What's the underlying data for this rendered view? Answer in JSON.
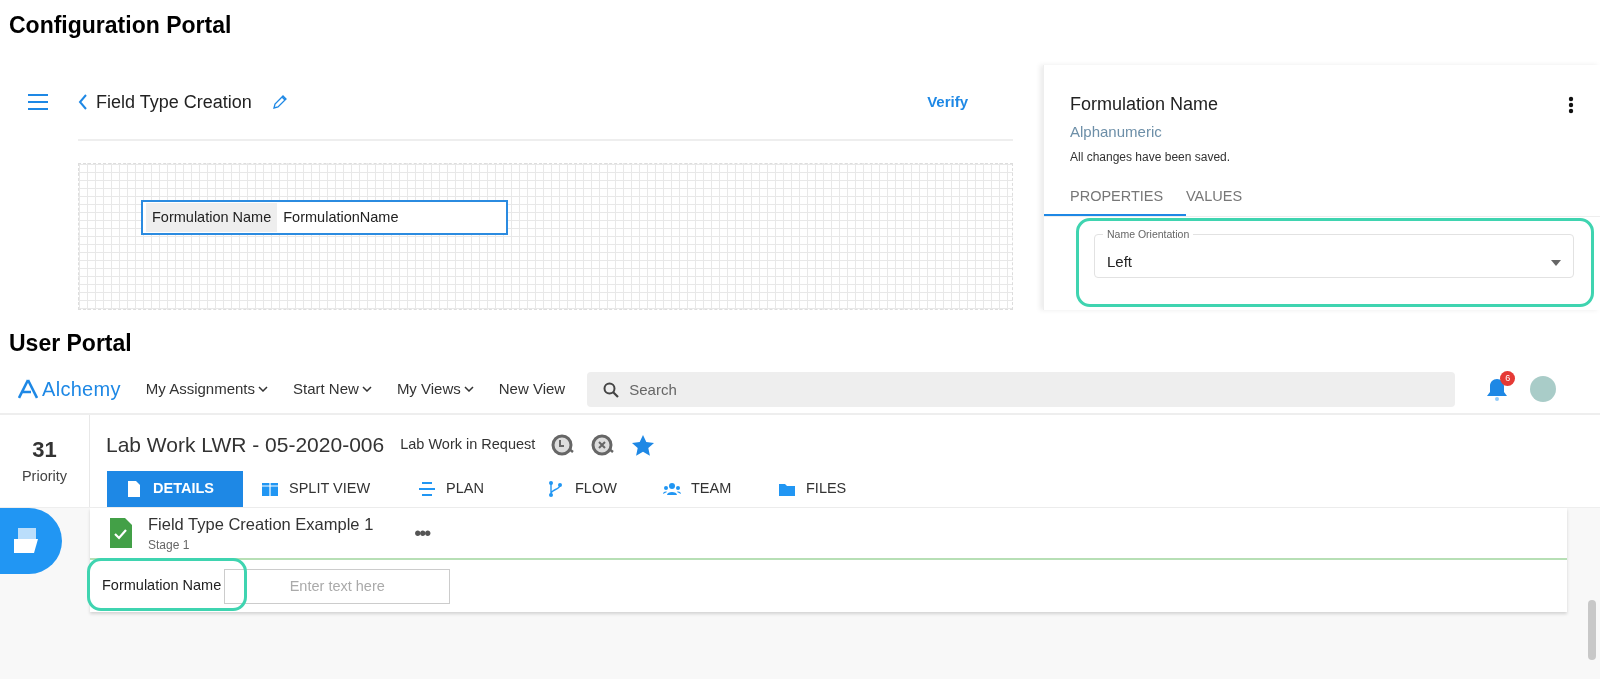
{
  "config_portal": {
    "heading": "Configuration Portal",
    "header": {
      "title": "Field Type Creation",
      "action": "Verify"
    },
    "canvas_field": {
      "label": "Formulation Name",
      "value": "FormulationName"
    },
    "properties_panel": {
      "title": "Formulation Name",
      "type": "Alphanumeric",
      "status": "All changes have been saved.",
      "tabs": [
        {
          "label": "PROPERTIES",
          "selected": true
        },
        {
          "label": "VALUES",
          "selected": false
        }
      ],
      "select": {
        "label": "Name Orientation",
        "value": "Left"
      }
    }
  },
  "user_portal": {
    "heading": "User Portal",
    "navbar": {
      "brand": "Alchemy",
      "menu": [
        {
          "label": "My Assignments",
          "dropdown": true
        },
        {
          "label": "Start New",
          "dropdown": true
        },
        {
          "label": "My Views",
          "dropdown": true
        },
        {
          "label": "New View",
          "dropdown": false
        }
      ],
      "search": {
        "placeholder": "Search"
      },
      "notifications": {
        "count": "6"
      }
    },
    "record": {
      "priority": {
        "value": "31",
        "label": "Priority"
      },
      "title": "Lab Work LWR - 05-2020-006",
      "status": "Lab Work in Request",
      "starred": true,
      "tabs": [
        {
          "label": "DETAILS",
          "selected": true,
          "kind": "document"
        },
        {
          "label": "SPLIT VIEW",
          "selected": false,
          "kind": "split"
        },
        {
          "label": "PLAN",
          "selected": false,
          "kind": "plan"
        },
        {
          "label": "FLOW",
          "selected": false,
          "kind": "flow"
        },
        {
          "label": "TEAM",
          "selected": false,
          "kind": "team"
        },
        {
          "label": "FILES",
          "selected": false,
          "kind": "folder"
        }
      ],
      "section": {
        "title": "Field Type Creation Example 1",
        "subtitle": "Stage 1",
        "more": "•••",
        "field": {
          "label": "Formulation Name",
          "placeholder": "Enter text here"
        }
      }
    }
  }
}
